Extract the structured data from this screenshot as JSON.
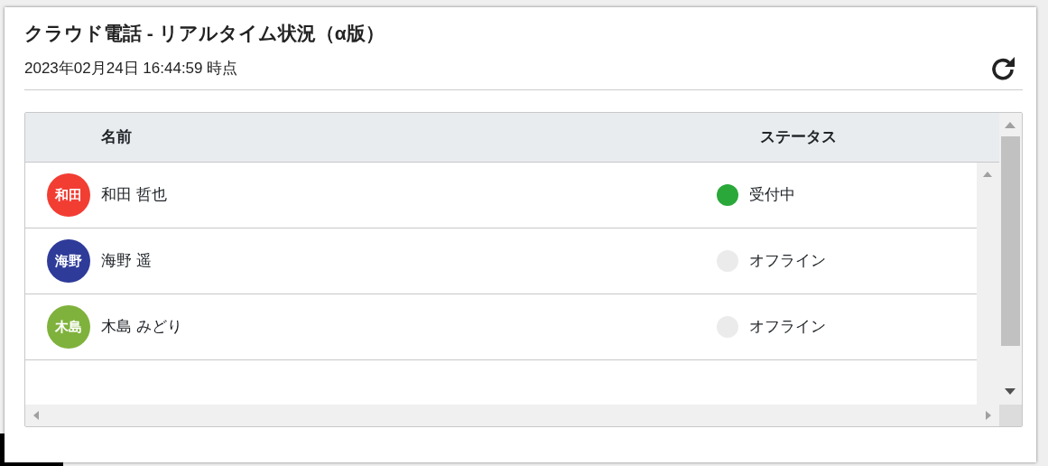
{
  "dialog": {
    "title": "クラウド電話 - リアルタイム状況（α版）",
    "timestamp": "2023年02月24日 16:44:59 時点"
  },
  "table": {
    "columns": [
      "名前",
      "ステータス"
    ],
    "rows": [
      {
        "avatar": {
          "label": "和田",
          "color": "#f23d33"
        },
        "name": "和田 哲也",
        "status": {
          "label": "受付中",
          "color": "#2aa83a"
        }
      },
      {
        "avatar": {
          "label": "海野",
          "color": "#2e3b99"
        },
        "name": "海野 遥",
        "status": {
          "label": "オフライン",
          "color": "#ebebeb"
        }
      },
      {
        "avatar": {
          "label": "木島",
          "color": "#7fb23c"
        },
        "name": "木島 みどり",
        "status": {
          "label": "オフライン",
          "color": "#ebebeb"
        }
      }
    ]
  }
}
